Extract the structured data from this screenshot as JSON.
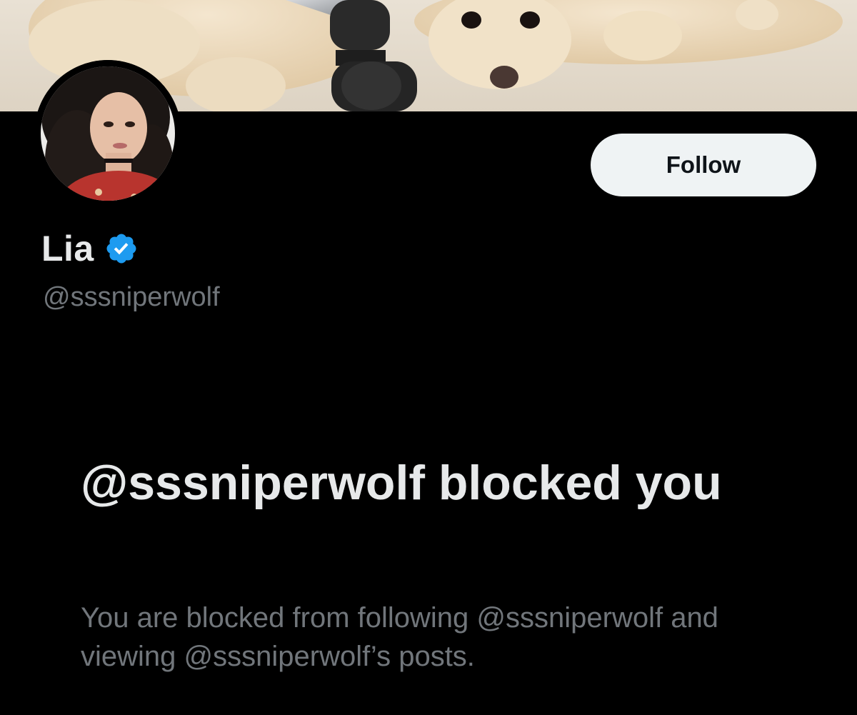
{
  "profile": {
    "display_name": "Lia",
    "handle": "@sssniperwolf",
    "verified": true,
    "follow_label": "Follow"
  },
  "blocked": {
    "title": "@sssniperwolf blocked you",
    "description": "You are blocked from following @sssniperwolf and viewing @sssniperwolf’s posts."
  },
  "icons": {
    "verified": "verified-badge-icon"
  },
  "colors": {
    "background": "#000000",
    "primary_text": "#e7e9ea",
    "secondary_text": "#71767b",
    "follow_button_bg": "#eff3f4",
    "follow_button_text": "#0f1419",
    "verified_blue": "#1d9bf0"
  }
}
